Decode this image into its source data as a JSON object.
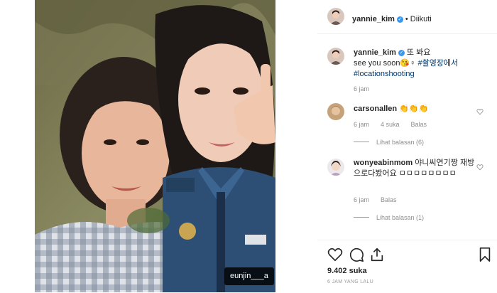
{
  "post": {
    "photo_tag": "eunjin___a"
  },
  "header": {
    "username": "yannie_kim",
    "follow_status": "Diikuti"
  },
  "caption": {
    "username": "yannie_kim",
    "line1": "또 봐요",
    "line2": "see you soon😘♀",
    "hashtag1": "#촬영장에서",
    "hashtag2": "#locationshooting",
    "time": "6 jam"
  },
  "comments": [
    {
      "username": "carsonallen",
      "text": "👏👏👏",
      "time": "6 jam",
      "likes": "4 suka",
      "reply": "Balas",
      "view_replies": "Lihat balasan (6)"
    },
    {
      "username": "wonyeabinmom",
      "text": "야니씨연기짱 재방으로다봤어요 ㅁㅁㅁㅁㅁㅁㅁㅁ",
      "time": "6 jam",
      "reply": "Balas",
      "view_replies": "Lihat balasan (1)"
    }
  ],
  "footer": {
    "likes": "9.402 suka",
    "time_ago": "6 JAM YANG LALU"
  },
  "icons": {
    "like": "heart-icon",
    "comment": "comment-icon",
    "share": "share-icon",
    "save": "bookmark-icon"
  }
}
